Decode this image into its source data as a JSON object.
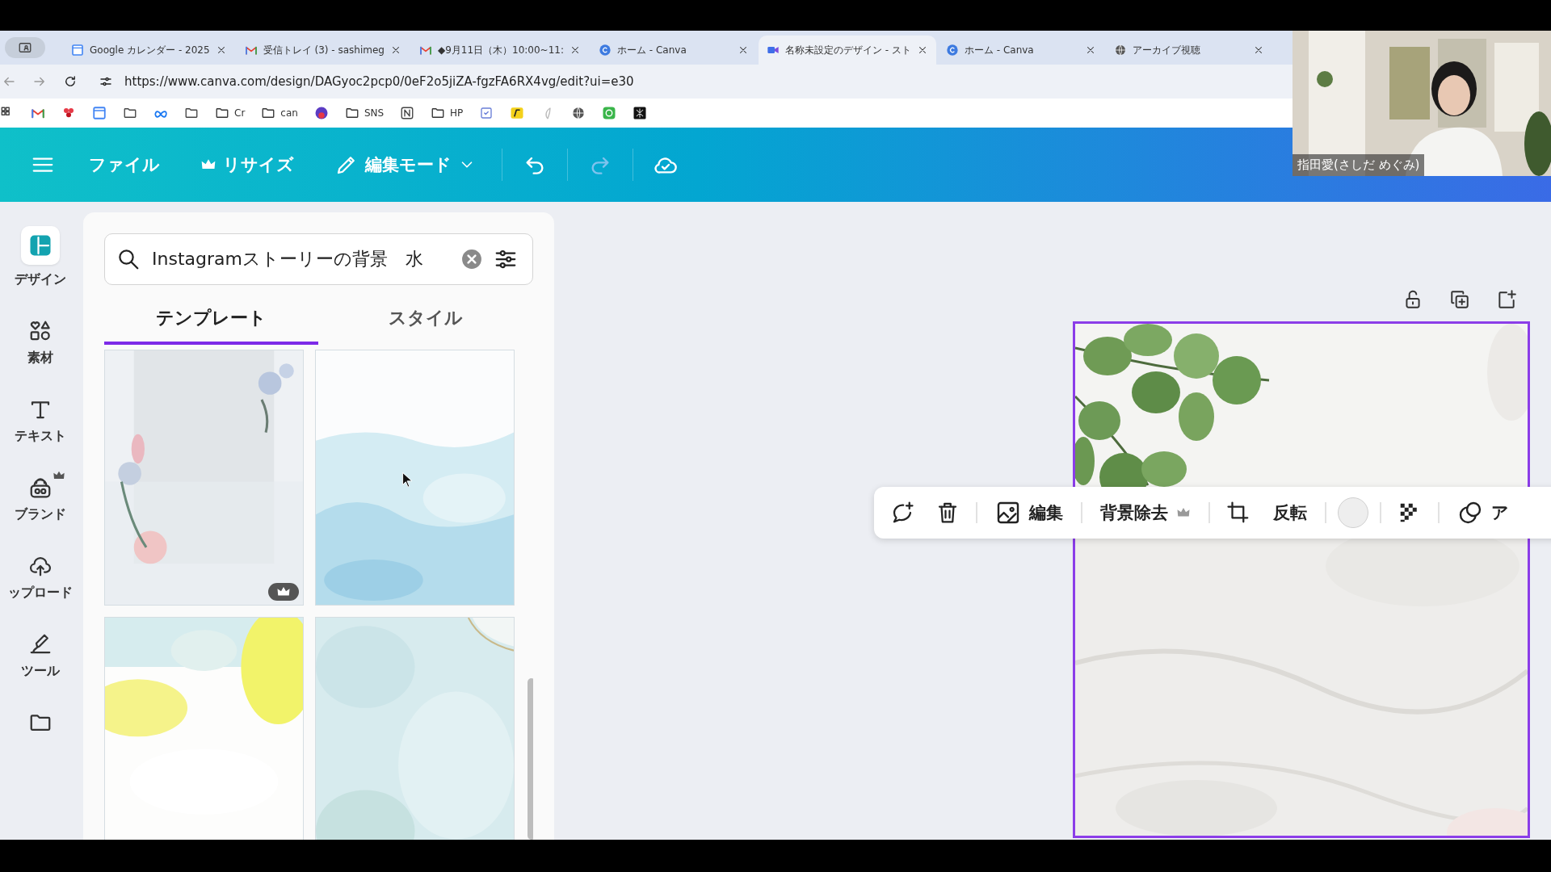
{
  "browser": {
    "tabs": [
      {
        "title": "Google カレンダー - 2025",
        "kind": "calendar",
        "selected": false
      },
      {
        "title": "受信トレイ (3) - sashimeg",
        "kind": "gmail",
        "selected": false
      },
      {
        "title": "◆9月11日（木）10:00~11:",
        "kind": "gmail",
        "selected": false
      },
      {
        "title": "ホーム - Canva",
        "kind": "canva",
        "selected": false
      },
      {
        "title": "名称未設定のデザイン - スト",
        "kind": "video",
        "selected": true
      },
      {
        "title": "ホーム - Canva",
        "kind": "canva",
        "selected": false
      },
      {
        "title": "アーカイブ視聴",
        "kind": "globe",
        "selected": false
      }
    ],
    "url": "https://www.canva.com/design/DAGyoc2pcp0/0eF2o5jiZA-fgzFA6RX4vg/edit?ui=e30",
    "bookmarks": [
      {
        "kind": "apps"
      },
      {
        "kind": "gmail"
      },
      {
        "kind": "flower"
      },
      {
        "kind": "calendar"
      },
      {
        "kind": "folder"
      },
      {
        "kind": "meta"
      },
      {
        "kind": "folder"
      },
      {
        "kind": "folder",
        "label": "Cr"
      },
      {
        "kind": "folder",
        "label": "can"
      },
      {
        "kind": "badge"
      },
      {
        "kind": "folder",
        "label": "SNS"
      },
      {
        "kind": "notion"
      },
      {
        "kind": "folder",
        "label": "HP"
      },
      {
        "kind": "check"
      },
      {
        "kind": "yellow"
      },
      {
        "kind": "grey"
      },
      {
        "kind": "globe"
      },
      {
        "kind": "green"
      },
      {
        "kind": "dark"
      }
    ]
  },
  "webcam": {
    "kind": "picture",
    "name": "指田愛(さしだ めぐみ)"
  },
  "header": {
    "items": [
      {
        "kind": "file",
        "label": "ファイル"
      },
      {
        "kind": "resize",
        "label": "リサイズ"
      },
      {
        "kind": "mode",
        "label": "編集モード"
      }
    ],
    "tools": [
      {
        "kind": "undo",
        "disabled": false
      },
      {
        "kind": "redo",
        "disabled": true
      },
      {
        "kind": "saved",
        "disabled": false
      }
    ]
  },
  "rail": [
    {
      "label": "デザイン",
      "kind": "design",
      "selected": true
    },
    {
      "label": "素材",
      "kind": "elements",
      "selected": false
    },
    {
      "label": "テキスト",
      "kind": "text",
      "selected": false
    },
    {
      "label": "ブランド",
      "kind": "brand",
      "selected": false
    },
    {
      "label": "ップロード",
      "kind": "upload",
      "selected": false
    },
    {
      "label": "ツール",
      "kind": "tools",
      "selected": false
    },
    {
      "kind": "projects",
      "selected": false
    }
  ],
  "panel": {
    "search": {
      "value": "Instagramストーリーの背景　水"
    },
    "tabs": [
      {
        "label": "テンプレート",
        "selected": true
      },
      {
        "label": "スタイル",
        "selected": false
      }
    ],
    "templates": [
      {
        "kind": "picture",
        "premium": true
      },
      {
        "kind": "picture",
        "premium": false
      },
      {
        "kind": "picture"
      },
      {
        "kind": "picture"
      }
    ]
  },
  "canvas": {
    "page": {
      "kind": "picture",
      "selected": true
    },
    "toolbar_groups": [
      {
        "items": [
          {
            "kind": "comment"
          },
          {
            "kind": "delete"
          }
        ]
      },
      {
        "items": [
          {
            "kind": "edit",
            "label": "編集"
          }
        ]
      },
      {
        "items": [
          {
            "kind": "bg-remove",
            "label": "背景除去"
          }
        ]
      },
      {
        "items": [
          {
            "kind": "crop"
          },
          {
            "kind": "flip",
            "label": "反転"
          }
        ]
      },
      {
        "items": [
          {
            "kind": "color"
          }
        ]
      },
      {
        "items": [
          {
            "kind": "transparency"
          }
        ]
      },
      {
        "items": [
          {
            "kind": "overlap",
            "label": "ア"
          }
        ]
      }
    ]
  }
}
